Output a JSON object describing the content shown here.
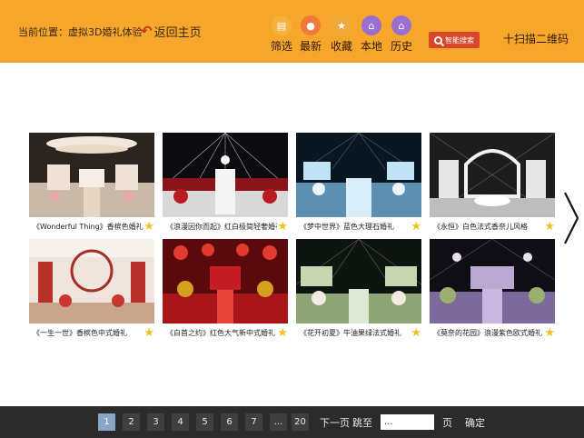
{
  "header": {
    "breadcrumb": "当前位置：虚拟3D婚礼体验",
    "back_label": "返回主页",
    "nav": [
      {
        "label": "筛选",
        "icon": "filter-icon",
        "color": "#f5b23c",
        "glyph": "▤"
      },
      {
        "label": "最新",
        "icon": "flame-icon",
        "color": "#f07a3a",
        "glyph": "●"
      },
      {
        "label": "收藏",
        "icon": "star-icon",
        "color": "#f0a83a",
        "glyph": "★"
      },
      {
        "label": "本地",
        "icon": "home-icon",
        "color": "#9a6fd0",
        "glyph": "⌂"
      },
      {
        "label": "历史",
        "icon": "home-icon",
        "color": "#9a6fd0",
        "glyph": "⌂"
      }
    ],
    "search_label": "智能搜索",
    "qr_label": "十扫描二维码"
  },
  "grid": {
    "items": [
      {
        "title": "《Wonderful Thing》香槟色婚礼",
        "theme": "champagne"
      },
      {
        "title": "《浪漫因你而起》红白极简轻奢婚礼",
        "theme": "red-white"
      },
      {
        "title": "《梦中世界》蓝色大理石婚礼",
        "theme": "blue-marble"
      },
      {
        "title": "《永恒》白色法式香奈儿风格",
        "theme": "white-chanel"
      },
      {
        "title": "《一生一世》香槟色中式婚礼",
        "theme": "champagne-chinese"
      },
      {
        "title": "《白首之约》红色大气新中式婚礼",
        "theme": "red-chinese"
      },
      {
        "title": "《花开初夏》牛油果绿法式婚礼",
        "theme": "green-french"
      },
      {
        "title": "《莫奈的花园》浪漫紫色欧式婚礼",
        "theme": "purple-european"
      }
    ]
  },
  "pagination": {
    "pages": [
      "1",
      "2",
      "3",
      "4",
      "5",
      "6",
      "7",
      "...",
      "20"
    ],
    "active_page": "1",
    "next_label": "下一页",
    "jump_label": "跳至",
    "jump_value": "...",
    "page_unit": "页",
    "confirm_label": "确定"
  }
}
